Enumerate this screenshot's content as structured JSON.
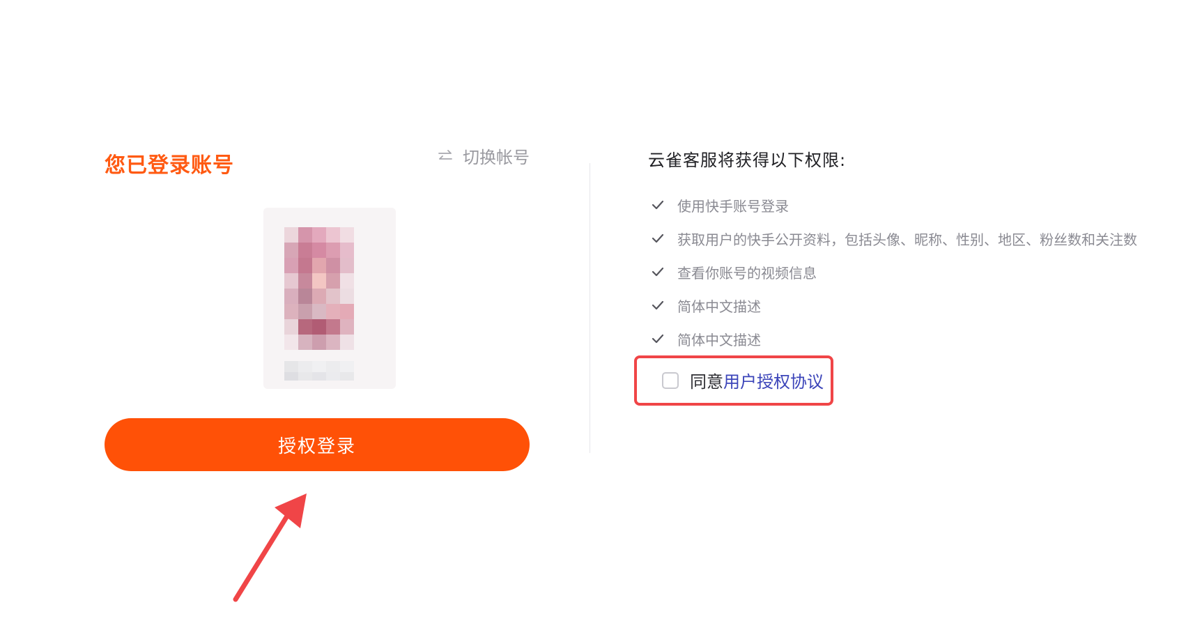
{
  "left": {
    "title": "您已登录账号",
    "switch_label": "切换帐号",
    "auth_button_label": "授权登录"
  },
  "right": {
    "title": "云雀客服将获得以下权限:",
    "permissions": [
      "使用快手账号登录",
      "获取用户的快手公开资料，包括头像、昵称、性别、地区、粉丝数和关注数",
      "查看你账号的视频信息",
      "简体中文描述",
      "简体中文描述"
    ],
    "agree_prefix": "同意",
    "agree_link": "用户授权协议"
  },
  "colors": {
    "brand_orange": "#ff5107",
    "title_orange": "#ff5a12",
    "link_blue": "#3b44b9",
    "annotation_red": "#f04547"
  },
  "icons": {
    "switch": "swap-arrows-icon",
    "permission": "check-icon",
    "annotation": "red-arrow-icon"
  }
}
